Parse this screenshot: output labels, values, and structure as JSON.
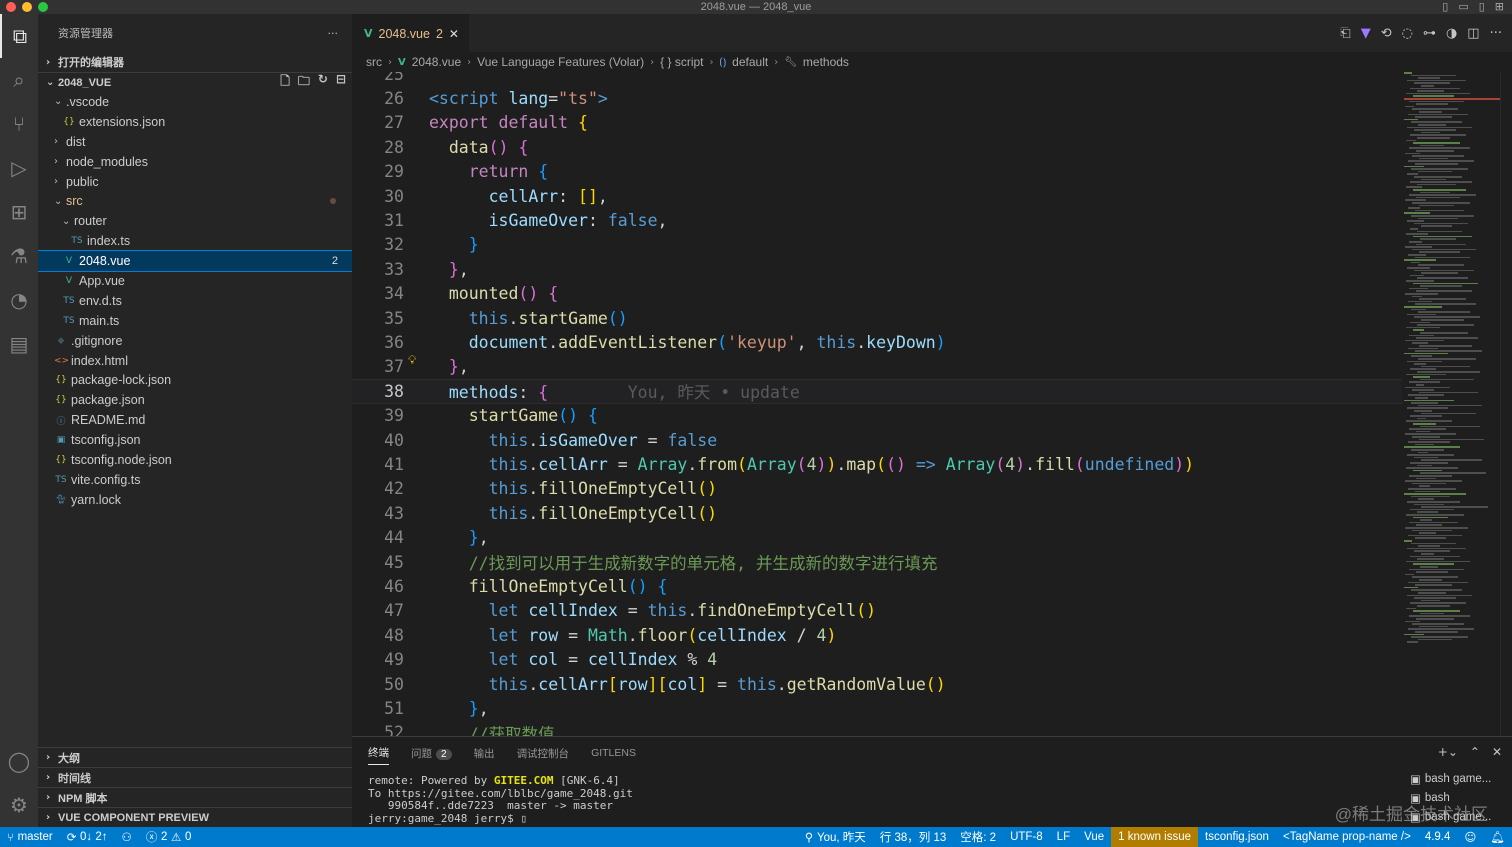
{
  "window": {
    "title": "2048.vue — 2048_vue"
  },
  "colors": {
    "accent": "#007acc",
    "vue": "#41b883",
    "modified": "#e2c08d",
    "warning_item": "#b07d00"
  },
  "activity_bar": {
    "items": [
      "explorer-icon",
      "search-icon",
      "source-control-icon",
      "run-debug-icon",
      "extensions-icon",
      "testing-icon",
      "gitlens-icon",
      "remote-icon"
    ],
    "bottom": [
      "accounts-icon",
      "settings-gear-icon"
    ]
  },
  "explorer": {
    "title": "资源管理器",
    "open_editors": "打开的编辑器",
    "project": "2048_VUE",
    "tree": [
      {
        "label": ".vscode",
        "type": "folder-open",
        "depth": 1
      },
      {
        "label": "extensions.json",
        "type": "json",
        "depth": 2
      },
      {
        "label": "dist",
        "type": "folder",
        "depth": 1
      },
      {
        "label": "node_modules",
        "type": "folder",
        "depth": 1
      },
      {
        "label": "public",
        "type": "folder",
        "depth": 1
      },
      {
        "label": "src",
        "type": "folder-open",
        "depth": 1,
        "modified": true
      },
      {
        "label": "router",
        "type": "folder-open",
        "depth": 2
      },
      {
        "label": "index.ts",
        "type": "ts",
        "depth": 3
      },
      {
        "label": "2048.vue",
        "type": "vue",
        "depth": 2,
        "selected": true,
        "badge": "2"
      },
      {
        "label": "App.vue",
        "type": "vue",
        "depth": 2
      },
      {
        "label": "env.d.ts",
        "type": "ts",
        "depth": 2
      },
      {
        "label": "main.ts",
        "type": "ts",
        "depth": 2
      },
      {
        "label": ".gitignore",
        "type": "git",
        "depth": 1
      },
      {
        "label": "index.html",
        "type": "html",
        "depth": 1
      },
      {
        "label": "package-lock.json",
        "type": "json",
        "depth": 1
      },
      {
        "label": "package.json",
        "type": "json",
        "depth": 1
      },
      {
        "label": "README.md",
        "type": "info",
        "depth": 1
      },
      {
        "label": "tsconfig.json",
        "type": "tsconfig",
        "depth": 1
      },
      {
        "label": "tsconfig.node.json",
        "type": "json",
        "depth": 1
      },
      {
        "label": "vite.config.ts",
        "type": "ts",
        "depth": 1
      },
      {
        "label": "yarn.lock",
        "type": "yarn",
        "depth": 1
      }
    ],
    "bottom_sections": [
      "大纲",
      "时间线",
      "NPM 脚本",
      "VUE COMPONENT PREVIEW"
    ]
  },
  "editor": {
    "tab": {
      "label": "2048.vue",
      "problems": "2"
    },
    "breadcrumb": [
      "src",
      "2048.vue",
      "Vue Language Features (Volar)",
      "{ } script",
      "default",
      "methods"
    ],
    "first_line": 25,
    "current_line": 38,
    "blame": "You, 昨天 • update",
    "lines": [
      [
        [
          "ln",
          "25"
        ],
        [
          "",
          "  "
        ]
      ],
      [
        [
          "tag",
          "<script "
        ],
        [
          "attr",
          "lang"
        ],
        [
          "",
          "="
        ],
        [
          "str",
          "\"ts\""
        ],
        [
          "tag",
          ">"
        ]
      ],
      [
        [
          "kw",
          "export "
        ],
        [
          "kw",
          "default "
        ],
        [
          "br1",
          "{"
        ]
      ],
      [
        [
          "",
          "  "
        ],
        [
          "fn",
          "data"
        ],
        [
          "br2",
          "()"
        ],
        [
          "",
          ""
        ],
        [
          "",
          " "
        ],
        [
          "br2",
          "{"
        ]
      ],
      [
        [
          "",
          "    "
        ],
        [
          "kw",
          "return "
        ],
        [
          "br3",
          "{"
        ]
      ],
      [
        [
          "",
          "      "
        ],
        [
          "prop",
          "cellArr"
        ],
        [
          "",
          ": "
        ],
        [
          "br1",
          "[]"
        ],
        [
          "",
          ","
        ]
      ],
      [
        [
          "",
          "      "
        ],
        [
          "prop",
          "isGameOver"
        ],
        [
          "",
          ": "
        ],
        [
          "kw2",
          "false"
        ],
        [
          "",
          ","
        ]
      ],
      [
        [
          "",
          "    "
        ],
        [
          "br3",
          "}"
        ]
      ],
      [
        [
          "",
          "  "
        ],
        [
          "br2",
          "}"
        ],
        [
          "",
          ","
        ]
      ],
      [
        [
          "",
          "  "
        ],
        [
          "fn",
          "mounted"
        ],
        [
          "br2",
          "()"
        ],
        [
          "",
          " "
        ],
        [
          "br2",
          "{"
        ]
      ],
      [
        [
          "",
          "    "
        ],
        [
          "kw2",
          "this"
        ],
        [
          "",
          "."
        ],
        [
          "fn",
          "startGame"
        ],
        [
          "br3",
          "()"
        ]
      ],
      [
        [
          "",
          "    "
        ],
        [
          "prop",
          "document"
        ],
        [
          "",
          "."
        ],
        [
          "fn",
          "addEventListener"
        ],
        [
          "br3",
          "("
        ],
        [
          "str",
          "'keyup'"
        ],
        [
          "",
          ", "
        ],
        [
          "kw2",
          "this"
        ],
        [
          "",
          "."
        ],
        [
          "prop",
          "keyDown"
        ],
        [
          "br3",
          ")"
        ]
      ],
      [
        [
          "",
          "  "
        ],
        [
          "br2",
          "}"
        ],
        [
          "",
          ","
        ]
      ],
      [
        [
          "",
          "  "
        ],
        [
          "prop",
          "methods"
        ],
        [
          "",
          ": "
        ],
        [
          "br2",
          "{"
        ],
        [
          "ghost",
          "        You, 昨天 • update"
        ]
      ],
      [
        [
          "",
          "    "
        ],
        [
          "fn",
          "startGame"
        ],
        [
          "br3",
          "()"
        ],
        [
          "",
          " "
        ],
        [
          "br3",
          "{"
        ]
      ],
      [
        [
          "",
          "      "
        ],
        [
          "kw2",
          "this"
        ],
        [
          "",
          "."
        ],
        [
          "prop",
          "isGameOver"
        ],
        [
          "",
          " = "
        ],
        [
          "kw2",
          "false"
        ]
      ],
      [
        [
          "",
          "      "
        ],
        [
          "kw2",
          "this"
        ],
        [
          "",
          "."
        ],
        [
          "prop",
          "cellArr"
        ],
        [
          "",
          " = "
        ],
        [
          "cls",
          "Array"
        ],
        [
          "",
          "."
        ],
        [
          "fn",
          "from"
        ],
        [
          "br1",
          "("
        ],
        [
          "cls",
          "Array"
        ],
        [
          "br2",
          "("
        ],
        [
          "num",
          "4"
        ],
        [
          "br2",
          ")"
        ],
        [
          "br1",
          ")"
        ],
        [
          "",
          "."
        ],
        [
          "fn",
          "map"
        ],
        [
          "br1",
          "("
        ],
        [
          "br2",
          "()"
        ],
        [
          "",
          " "
        ],
        [
          "kw2",
          "=>"
        ],
        [
          "",
          " "
        ],
        [
          "cls",
          "Array"
        ],
        [
          "br2",
          "("
        ],
        [
          "num",
          "4"
        ],
        [
          "br2",
          ")"
        ],
        [
          "",
          "."
        ],
        [
          "fn",
          "fill"
        ],
        [
          "br2",
          "("
        ],
        [
          "kw2",
          "undefined"
        ],
        [
          "br2",
          ")"
        ],
        [
          "br1",
          ")"
        ]
      ],
      [
        [
          "",
          "      "
        ],
        [
          "kw2",
          "this"
        ],
        [
          "",
          "."
        ],
        [
          "fn",
          "fillOneEmptyCell"
        ],
        [
          "br1",
          "()"
        ]
      ],
      [
        [
          "",
          "      "
        ],
        [
          "kw2",
          "this"
        ],
        [
          "",
          "."
        ],
        [
          "fn",
          "fillOneEmptyCell"
        ],
        [
          "br1",
          "()"
        ]
      ],
      [
        [
          "",
          "    "
        ],
        [
          "br3",
          "}"
        ],
        [
          "",
          ","
        ]
      ],
      [
        [
          "",
          "    "
        ],
        [
          "cmt",
          "//找到可以用于生成新数字的单元格, 并生成新的数字进行填充"
        ]
      ],
      [
        [
          "",
          "    "
        ],
        [
          "fn",
          "fillOneEmptyCell"
        ],
        [
          "br3",
          "()"
        ],
        [
          "",
          " "
        ],
        [
          "br3",
          "{"
        ]
      ],
      [
        [
          "",
          "      "
        ],
        [
          "kw2",
          "let "
        ],
        [
          "prop",
          "cellIndex"
        ],
        [
          "",
          " = "
        ],
        [
          "kw2",
          "this"
        ],
        [
          "",
          "."
        ],
        [
          "fn",
          "findOneEmptyCell"
        ],
        [
          "br1",
          "()"
        ]
      ],
      [
        [
          "",
          "      "
        ],
        [
          "kw2",
          "let "
        ],
        [
          "prop",
          "row"
        ],
        [
          "",
          " = "
        ],
        [
          "cls",
          "Math"
        ],
        [
          "",
          "."
        ],
        [
          "fn",
          "floor"
        ],
        [
          "br1",
          "("
        ],
        [
          "prop",
          "cellIndex"
        ],
        [
          "",
          " / "
        ],
        [
          "num",
          "4"
        ],
        [
          "br1",
          ")"
        ]
      ],
      [
        [
          "",
          "      "
        ],
        [
          "kw2",
          "let "
        ],
        [
          "prop",
          "col"
        ],
        [
          "",
          " = "
        ],
        [
          "prop",
          "cellIndex"
        ],
        [
          "",
          " % "
        ],
        [
          "num",
          "4"
        ]
      ],
      [
        [
          "",
          "      "
        ],
        [
          "kw2",
          "this"
        ],
        [
          "",
          "."
        ],
        [
          "prop",
          "cellArr"
        ],
        [
          "br1",
          "["
        ],
        [
          "prop",
          "row"
        ],
        [
          "br1",
          "]"
        ],
        [
          "br1",
          "["
        ],
        [
          "prop",
          "col"
        ],
        [
          "br1",
          "]"
        ],
        [
          "",
          " = "
        ],
        [
          "kw2",
          "this"
        ],
        [
          "",
          "."
        ],
        [
          "fn",
          "getRandomValue"
        ],
        [
          "br1",
          "()"
        ]
      ],
      [
        [
          "",
          "    "
        ],
        [
          "br3",
          "}"
        ],
        [
          "",
          ","
        ]
      ],
      [
        [
          "",
          "    "
        ],
        [
          "cmt",
          "//获取数值"
        ]
      ]
    ]
  },
  "panel": {
    "tabs": [
      "终端",
      "问题",
      "输出",
      "调试控制台",
      "GITLENS"
    ],
    "problems_count": "2",
    "terminal_lines": [
      [
        "remote: Powered by ",
        "GITEE.COM",
        " [GNK-6.4]"
      ],
      [
        "To https://gitee.com/lblbc/game_2048.git",
        "",
        ""
      ],
      [
        "   990584f..dde7223  master -> master",
        "",
        ""
      ],
      [
        "jerry:game_2048 jerry$ ",
        "",
        ""
      ]
    ],
    "terminals": [
      "bash  game...",
      "bash",
      "bash  game..."
    ]
  },
  "statusbar": {
    "branch": "master",
    "sync": "0↓ 2↑",
    "errors": "2",
    "warnings": "0",
    "blame": "You, 昨天",
    "position": "行 38，列 13",
    "indent": "空格: 2",
    "encoding": "UTF-8",
    "eol": "LF",
    "language": "Vue",
    "issue": "1 known issue",
    "tsconfig": "tsconfig.json",
    "tagname": "<TagName prop-name />",
    "version": "4.9.4"
  },
  "watermark": "@稀土掘金技术社区"
}
